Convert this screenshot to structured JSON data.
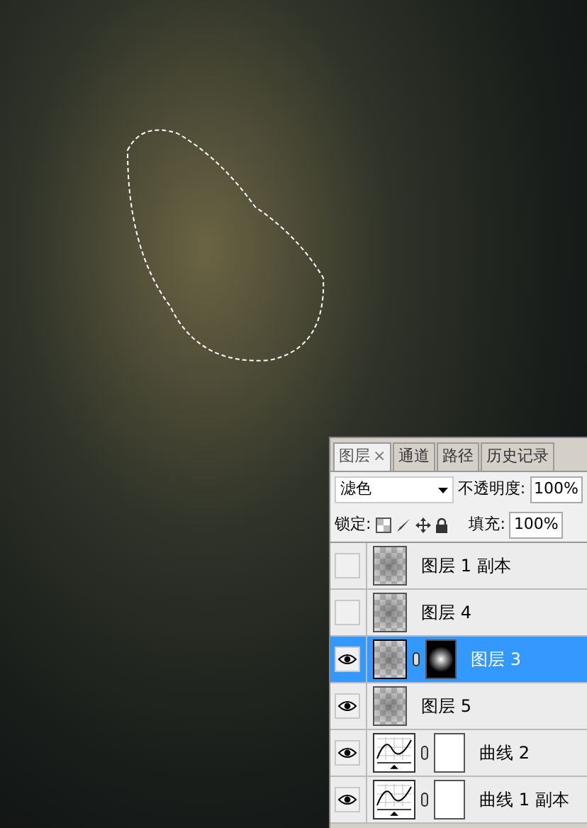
{
  "panel": {
    "tabs": [
      {
        "label": "图层",
        "selected": true,
        "close": "×"
      },
      {
        "label": "通道",
        "selected": false
      },
      {
        "label": "路径",
        "selected": false
      },
      {
        "label": "历史记录",
        "selected": false
      }
    ],
    "blend_mode": "滤色",
    "opacity_label": "不透明度:",
    "opacity": "100%",
    "lock_label": "锁定:",
    "fill_label": "填充:",
    "fill": "100%",
    "layers": [
      {
        "name": "图层 1 副本",
        "kind": "pixel",
        "visible": false,
        "selected": false,
        "mask": false
      },
      {
        "name": "图层 4",
        "kind": "pixel",
        "visible": false,
        "selected": false,
        "mask": false
      },
      {
        "name": "图层 3",
        "kind": "pixel",
        "visible": true,
        "selected": true,
        "mask": true
      },
      {
        "name": "图层 5",
        "kind": "pixel",
        "visible": true,
        "selected": false,
        "mask": false
      },
      {
        "name": "曲线 2",
        "kind": "curves",
        "visible": true,
        "selected": false,
        "mask": true
      },
      {
        "name": "曲线 1 副本",
        "kind": "curves",
        "visible": true,
        "selected": false,
        "mask": true
      }
    ]
  }
}
